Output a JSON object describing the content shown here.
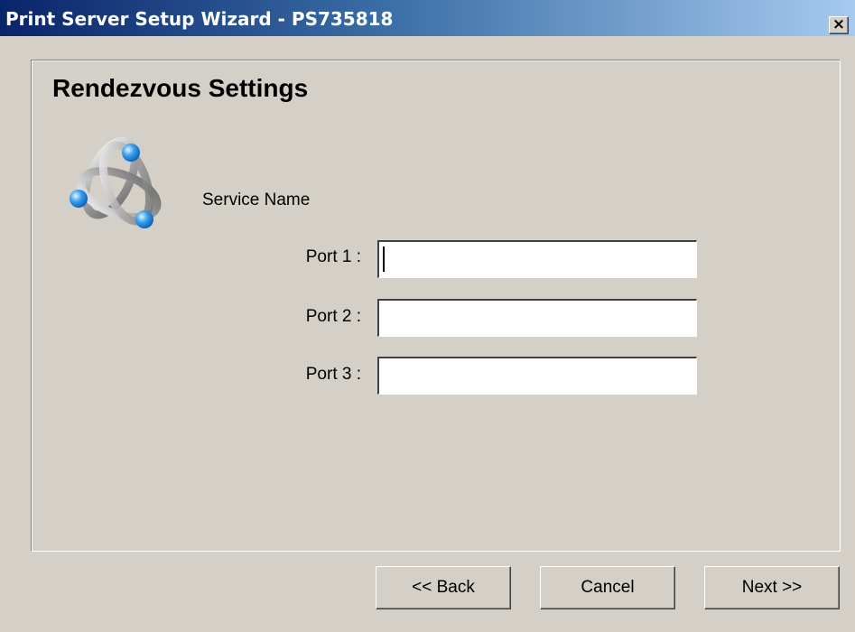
{
  "window": {
    "title": "Print Server Setup Wizard - PS735818",
    "close_glyph": "✕"
  },
  "page": {
    "heading": "Rendezvous Settings",
    "logo_icon": "rendezvous-logo-icon",
    "service_name_label": "Service Name"
  },
  "ports": [
    {
      "label": "Port 1 :",
      "value": "",
      "focused": true
    },
    {
      "label": "Port 2 :",
      "value": "",
      "focused": false
    },
    {
      "label": "Port 3 :",
      "value": "",
      "focused": false
    }
  ],
  "buttons": {
    "back": "<< Back",
    "cancel": "Cancel",
    "next": "Next >>"
  },
  "colors": {
    "face": "#d4d0c8",
    "title_gradient_start": "#0a246a",
    "title_gradient_end": "#a6caf0",
    "logo_blue": "#3aa0f0"
  }
}
